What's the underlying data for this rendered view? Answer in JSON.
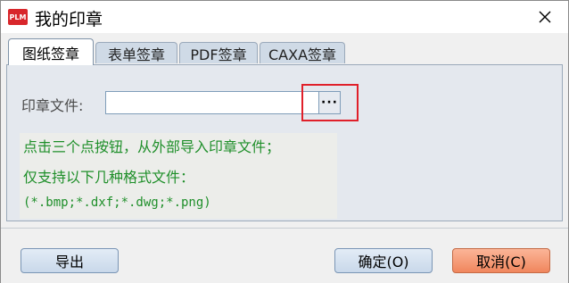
{
  "window": {
    "app_icon_text": "PLM",
    "title": "我的印章"
  },
  "tabs": [
    {
      "label": "图纸签章",
      "active": true
    },
    {
      "label": "表单签章",
      "active": false
    },
    {
      "label": "PDF签章",
      "active": false
    },
    {
      "label": "CAXA签章",
      "active": false
    }
  ],
  "panel": {
    "file_label": "印章文件:",
    "file_value": "",
    "browse_label": "···",
    "hints": [
      "点击三个点按钮，从外部导入印章文件；",
      "仅支持以下几种格式文件：",
      "(*.bmp;*.dxf;*.dwg;*.png)"
    ]
  },
  "footer": {
    "export_label": "导出",
    "ok_label": "确定(O)",
    "cancel_label": "取消(C)"
  },
  "colors": {
    "hint_text": "#1f8f2a",
    "highlight": "#e0202a",
    "cancel_button": "#f0865d"
  }
}
